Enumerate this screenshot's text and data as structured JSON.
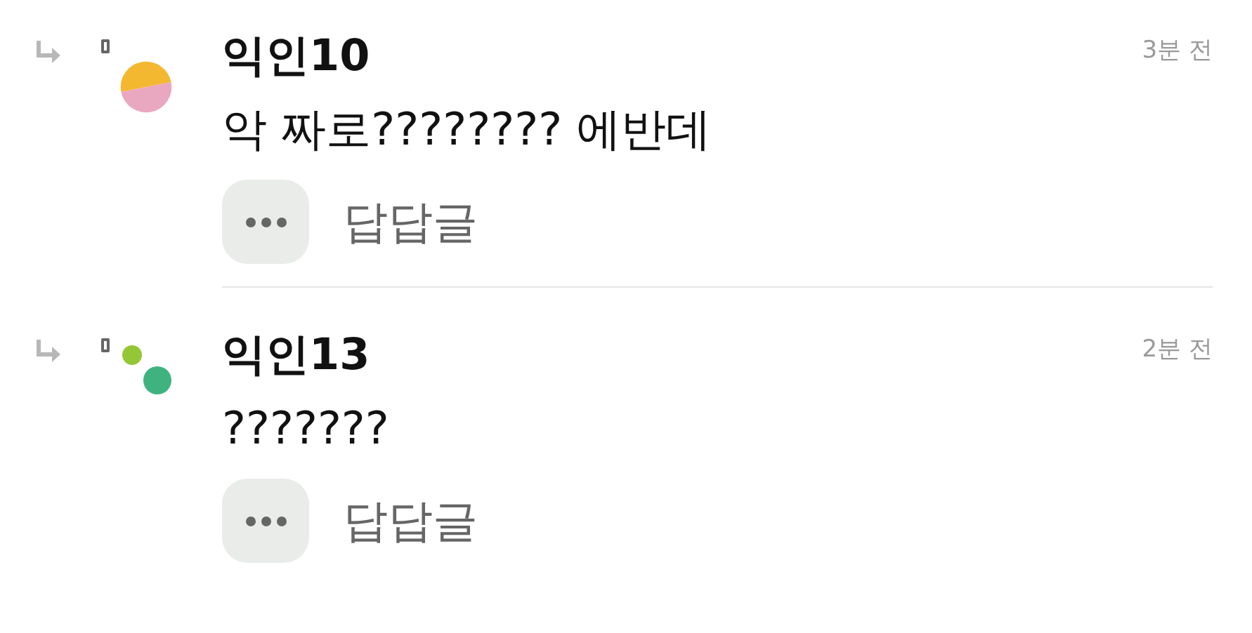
{
  "comments": [
    {
      "avatar": {
        "kind": "halves"
      },
      "author": "익인10",
      "time": "3분 전",
      "text": "악 짜로???????? 에반데",
      "reply_label": "답답글"
    },
    {
      "avatar": {
        "kind": "dots"
      },
      "author": "익인13",
      "time": "2분 전",
      "text": "???????",
      "reply_label": "답답글"
    }
  ]
}
